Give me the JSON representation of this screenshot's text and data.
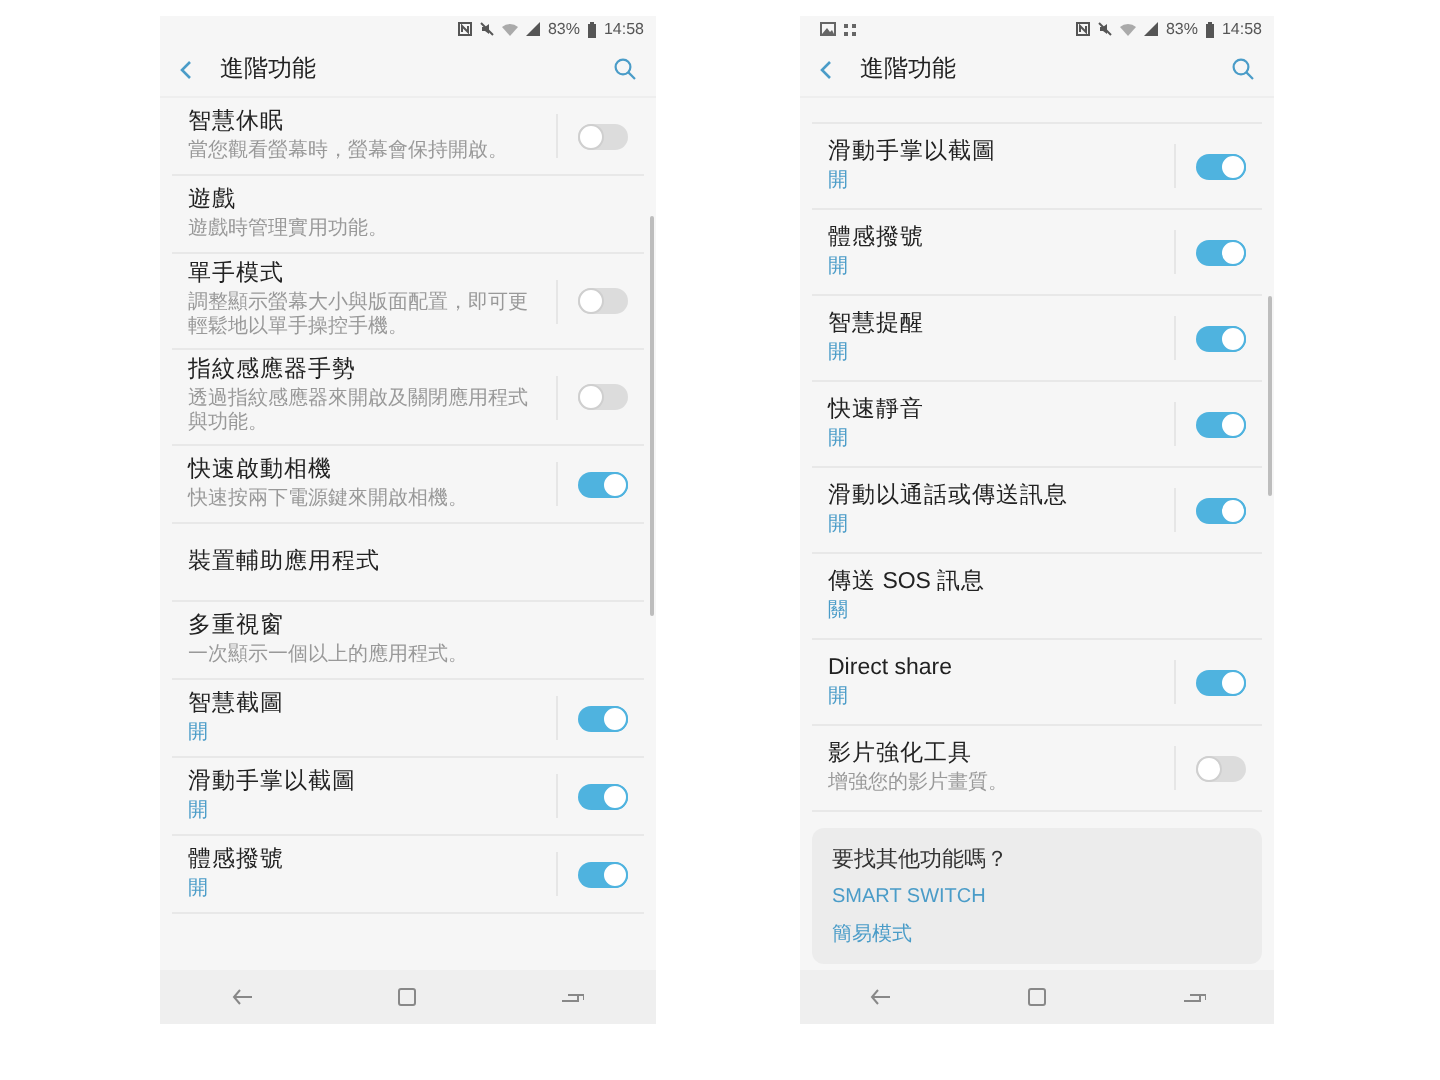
{
  "screens": [
    {
      "status_bar": {
        "notification_icons": false,
        "battery": "83%",
        "time": "14:58"
      },
      "app_bar": {
        "title": "進階功能"
      },
      "items": [
        {
          "kind": "toggle",
          "title": "智慧休眠",
          "description": "當您觀看螢幕時，螢幕會保持開啟。",
          "on": false
        },
        {
          "kind": "plain",
          "title": "遊戲",
          "description": "遊戲時管理實用功能。"
        },
        {
          "kind": "toggle",
          "title": "單手模式",
          "description": "調整顯示螢幕大小與版面配置，即可更輕鬆地以單手操控手機。",
          "on": false
        },
        {
          "kind": "toggle",
          "title": "指紋感應器手勢",
          "description": "透過指紋感應器來開啟及關閉應用程式與功能。",
          "on": false
        },
        {
          "kind": "toggle",
          "title": "快速啟動相機",
          "description": "快速按兩下電源鍵來開啟相機。",
          "on": true
        },
        {
          "kind": "plain",
          "title": "裝置輔助應用程式"
        },
        {
          "kind": "plain",
          "title": "多重視窗",
          "description": "一次顯示一個以上的應用程式。"
        },
        {
          "kind": "toggle",
          "title": "智慧截圖",
          "status": "開",
          "on": true
        },
        {
          "kind": "toggle",
          "title": "滑動手掌以截圖",
          "status": "開",
          "on": true
        },
        {
          "kind": "toggle",
          "title": "體感撥號",
          "status": "開",
          "on": true
        }
      ]
    },
    {
      "status_bar": {
        "notification_icons": true,
        "battery": "83%",
        "time": "14:58"
      },
      "app_bar": {
        "title": "進階功能"
      },
      "items": [
        {
          "kind": "toggle",
          "title": "滑動手掌以截圖",
          "status": "開",
          "on": true
        },
        {
          "kind": "toggle",
          "title": "體感撥號",
          "status": "開",
          "on": true
        },
        {
          "kind": "toggle",
          "title": "智慧提醒",
          "status": "開",
          "on": true
        },
        {
          "kind": "toggle",
          "title": "快速靜音",
          "status": "開",
          "on": true
        },
        {
          "kind": "toggle",
          "title": "滑動以通話或傳送訊息",
          "status": "開",
          "on": true
        },
        {
          "kind": "plain",
          "title": "傳送 SOS 訊息",
          "status": "關"
        },
        {
          "kind": "toggle",
          "title": "Direct share",
          "status": "開",
          "on": true
        },
        {
          "kind": "toggle",
          "title": "影片強化工具",
          "description": "增強您的影片畫質。",
          "on": false
        }
      ],
      "card": {
        "title": "要找其他功能嗎？",
        "links": [
          "SMART SWITCH",
          "簡易模式"
        ]
      }
    }
  ]
}
